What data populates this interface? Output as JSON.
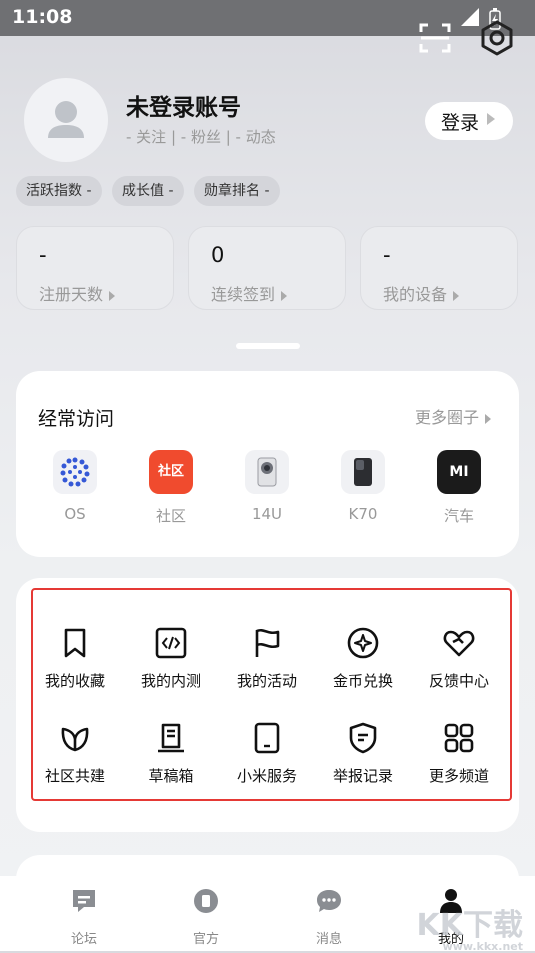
{
  "status_bar": {
    "time": "11:08"
  },
  "profile": {
    "username": "未登录账号",
    "substats": "- 关注 | - 粉丝 | - 动态",
    "login_label": "登录",
    "chips": [
      "活跃指数 -",
      "成长值 -",
      "勋章排名 -"
    ]
  },
  "stats": [
    {
      "value": "-",
      "label": "注册天数"
    },
    {
      "value": "0",
      "label": "连续签到"
    },
    {
      "value": "-",
      "label": "我的设备"
    }
  ],
  "frequent": {
    "title": "经常访问",
    "more_label": "更多圈子",
    "items": [
      {
        "label": "OS",
        "icon": "os-dots-icon"
      },
      {
        "label": "社区",
        "icon": "community-logo-icon",
        "badge_text": "社区"
      },
      {
        "label": "14U",
        "icon": "phone-14u-icon"
      },
      {
        "label": "K70",
        "icon": "phone-k70-icon"
      },
      {
        "label": "汽车",
        "icon": "mi-car-logo-icon",
        "badge_text": "MI"
      }
    ]
  },
  "functions": [
    {
      "label": "我的收藏",
      "icon": "bookmark-icon"
    },
    {
      "label": "我的内测",
      "icon": "code-icon"
    },
    {
      "label": "我的活动",
      "icon": "flag-icon"
    },
    {
      "label": "金币兑换",
      "icon": "coin-icon"
    },
    {
      "label": "反馈中心",
      "icon": "heart-icon"
    },
    {
      "label": "社区共建",
      "icon": "leaf-icon"
    },
    {
      "label": "草稿箱",
      "icon": "draft-icon"
    },
    {
      "label": "小米服务",
      "icon": "tablet-icon"
    },
    {
      "label": "举报记录",
      "icon": "shield-icon"
    },
    {
      "label": "更多频道",
      "icon": "grid-icon"
    }
  ],
  "nav": [
    {
      "label": "论坛",
      "icon": "forum-icon"
    },
    {
      "label": "官方",
      "icon": "official-icon"
    },
    {
      "label": "消息",
      "icon": "message-icon"
    },
    {
      "label": "我的",
      "icon": "person-icon",
      "active": true
    }
  ],
  "watermark": {
    "text": "KK下载",
    "sub": "www.kkx.net"
  },
  "colors": {
    "highlight_border": "#e53935",
    "community_red": "#f04b2e",
    "car_dark": "#1b1b1b"
  }
}
